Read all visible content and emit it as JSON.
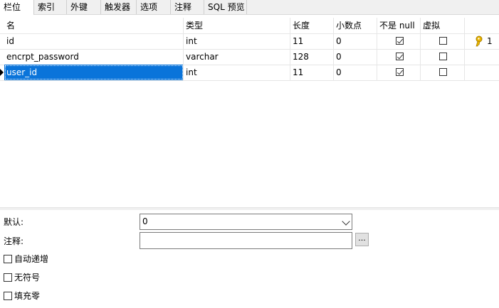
{
  "tabs": [
    "栏位",
    "索引",
    "外键",
    "触发器",
    "选项",
    "注释",
    "SQL 预览"
  ],
  "columns": [
    "名",
    "类型",
    "长度",
    "小数点",
    "不是 null",
    "虚拟"
  ],
  "rows": [
    {
      "name": "id",
      "type": "int",
      "length": "11",
      "decimals": "0",
      "not_null": true,
      "virtual": false,
      "key": "1"
    },
    {
      "name": "encrpt_password",
      "type": "varchar",
      "length": "128",
      "decimals": "0",
      "not_null": true,
      "virtual": false,
      "key": ""
    },
    {
      "name": "user_id",
      "type": "int",
      "length": "11",
      "decimals": "0",
      "not_null": true,
      "virtual": false,
      "key": ""
    }
  ],
  "props": {
    "default_label": "默认:",
    "default_value": "0",
    "comment_label": "注释:",
    "comment_value": "",
    "more_button": "...",
    "auto_increment_label": "自动递增",
    "unsigned_label": "无符号",
    "zerofill_label": "填充零"
  },
  "colors": {
    "selection": "#0a74da",
    "key": "#e8b400"
  }
}
